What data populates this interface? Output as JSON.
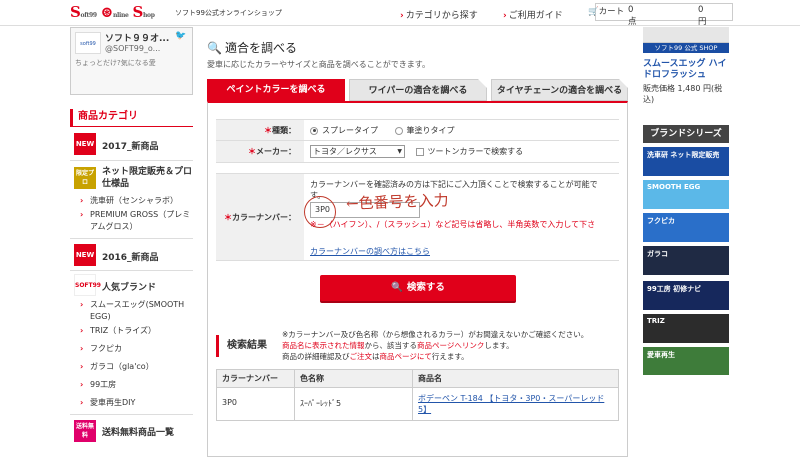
{
  "header": {
    "logo_prefix": "S",
    "logo_small1": "oft99",
    "logo_small2": "nline",
    "logo_small3": "hop",
    "shop_name": "ソフト99公式オンラインショップ",
    "link_category": "カテゴリから探す",
    "link_guide": "ご利用ガイド",
    "cart_label": "カート",
    "cart_points": "0点",
    "cart_total": "0円"
  },
  "sidebar": {
    "twitter_name": "ソフト９９オ...",
    "twitter_handle": "@SOFT99_o...",
    "twitter_text": "ちょっとだけ?気になる愛",
    "twitter_avatar": "soft99",
    "category_title": "商品カテゴリ",
    "items": [
      {
        "badge": "NEW",
        "label": "2017_新商品"
      },
      {
        "badge": "限定プロ",
        "label": "ネット限定販売＆プロ仕様品"
      },
      {
        "sub": "洗車研（センシャラボ）"
      },
      {
        "sub": "PREMIUM GROSS（プレミアムグロス）"
      },
      {
        "badge": "NEW",
        "label": "2016_新商品"
      },
      {
        "badge": "SOFT99",
        "label": "人気ブランド"
      },
      {
        "sub": "スムースエッグ(SMOOTH EGG)"
      },
      {
        "sub": "TRIZ（トライズ）"
      },
      {
        "sub": "フクピカ"
      },
      {
        "sub": "ガラコ（gla'co）"
      },
      {
        "sub": "99工房"
      },
      {
        "sub": "愛車再生DIY"
      },
      {
        "badge": "送料無料",
        "label": "送料無料商品一覧"
      }
    ]
  },
  "main": {
    "title": "適合を調べる",
    "description": "愛車に応じたカラーやサイズと商品を調べることができます。",
    "tabs": [
      {
        "label": "ペイントカラーを調べる"
      },
      {
        "label": "ワイパーの適合を調べる"
      },
      {
        "label": "タイヤチェーンの適合を調べる"
      }
    ],
    "form": {
      "type_label": "種類：",
      "type_opt1": "スプレータイプ",
      "type_opt2": "筆塗りタイプ",
      "maker_label": "メーカー：",
      "maker_value": "トヨタ／レクサス",
      "two_tone": "ツートンカラーで検索する",
      "color_label": "カラーナンバー：",
      "color_desc1": "カラーナンバーを確認済みの方は下記にご入力頂くことで検索することが可能で",
      "color_desc2": "す。",
      "color_value": "3P0",
      "annotation": "←色番号を入力",
      "color_note": "※－（ハイフン）、/（スラッシュ）など記号は省略し、半角英数で入力して下さ",
      "color_link": "カラーナンバーの調べ方はこちら",
      "search_button": "検索する"
    },
    "results": {
      "title": "検索結果",
      "note1": "※カラーナンバー及び色名称（から想像されるカラー）がお間違えないかご確認ください。",
      "note2_a": "商品名に表示された情報",
      "note2_b": "から、該当する",
      "note2_c": "商品ページへリンク",
      "note2_d": "します。",
      "note3_a": "商品の詳細確認及び",
      "note3_b": "ご注文",
      "note3_c": "は",
      "note3_d": "商品ページにて",
      "note3_e": "行えます。",
      "columns": [
        "カラーナンバー",
        "色名称",
        "商品名"
      ],
      "rows": [
        {
          "code": "3P0",
          "name": "ｽｰﾊﾟｰﾚｯﾄﾞ5",
          "product1": "ボデーペン T-184 【トヨタ・3P0・スーパーレッド",
          "product2": "5】"
        }
      ]
    }
  },
  "right": {
    "product_bar": "ソフト99 公式 SHOP",
    "product_name": "スムースエッグ ハイドロフラッシュ",
    "product_price": "販売価格 1,480 円(税込)",
    "brand_title": "ブランドシリーズ",
    "brands": [
      {
        "label": "洗車研 ネット限定販売",
        "color": "#1a4da3"
      },
      {
        "label": "SMOOTH EGG",
        "color": "#5bb8e8"
      },
      {
        "label": "フクピカ",
        "color": "#2a6fc9"
      },
      {
        "label": "ガラコ",
        "color": "#1f2a44"
      },
      {
        "label": "99工房 初修ナビ",
        "color": "#16285c"
      },
      {
        "label": "TRIZ",
        "color": "#2c2c2c"
      },
      {
        "label": "愛車再生",
        "color": "#3e7c3a"
      }
    ]
  }
}
